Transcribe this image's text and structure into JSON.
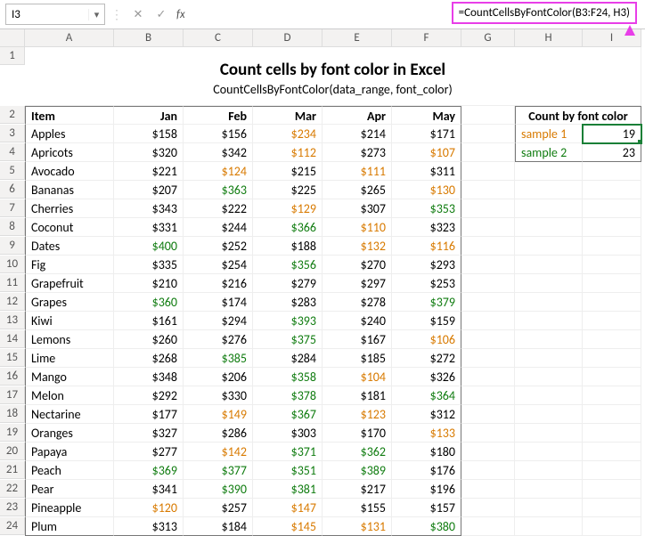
{
  "formula_bar": {
    "cell_ref": "I3",
    "formula_display": "=CountCellsByFontColor(B3:F24, H3)",
    "fx_label": "fx"
  },
  "columns": [
    "A",
    "B",
    "C",
    "D",
    "E",
    "F",
    "G",
    "H",
    "I"
  ],
  "title": {
    "main": "Count cells by font color in Excel",
    "sub": "CountCellsByFontColor(data_range, font_color)"
  },
  "data_headers": {
    "item": "Item",
    "months": [
      "Jan",
      "Feb",
      "Mar",
      "Apr",
      "May"
    ]
  },
  "count_box": {
    "header": "Count by font color",
    "rows": [
      {
        "label": "sample 1",
        "color": "org",
        "value": "19"
      },
      {
        "label": "sample 2",
        "color": "grn",
        "value": "23"
      }
    ]
  },
  "rows": [
    {
      "n": "3",
      "item": "Apples",
      "v": [
        {
          "t": "$158",
          "c": "blk"
        },
        {
          "t": "$156",
          "c": "blk"
        },
        {
          "t": "$234",
          "c": "org"
        },
        {
          "t": "$214",
          "c": "blk"
        },
        {
          "t": "$171",
          "c": "blk"
        }
      ]
    },
    {
      "n": "4",
      "item": "Apricots",
      "v": [
        {
          "t": "$320",
          "c": "blk"
        },
        {
          "t": "$342",
          "c": "blk"
        },
        {
          "t": "$112",
          "c": "org"
        },
        {
          "t": "$273",
          "c": "blk"
        },
        {
          "t": "$107",
          "c": "org"
        }
      ]
    },
    {
      "n": "5",
      "item": "Avocado",
      "v": [
        {
          "t": "$221",
          "c": "blk"
        },
        {
          "t": "$124",
          "c": "org"
        },
        {
          "t": "$215",
          "c": "blk"
        },
        {
          "t": "$111",
          "c": "org"
        },
        {
          "t": "$311",
          "c": "blk"
        }
      ]
    },
    {
      "n": "6",
      "item": "Bananas",
      "v": [
        {
          "t": "$207",
          "c": "blk"
        },
        {
          "t": "$363",
          "c": "grn"
        },
        {
          "t": "$225",
          "c": "blk"
        },
        {
          "t": "$265",
          "c": "blk"
        },
        {
          "t": "$130",
          "c": "org"
        }
      ]
    },
    {
      "n": "7",
      "item": "Cherries",
      "v": [
        {
          "t": "$343",
          "c": "blk"
        },
        {
          "t": "$222",
          "c": "blk"
        },
        {
          "t": "$129",
          "c": "org"
        },
        {
          "t": "$307",
          "c": "blk"
        },
        {
          "t": "$353",
          "c": "grn"
        }
      ]
    },
    {
      "n": "8",
      "item": "Coconut",
      "v": [
        {
          "t": "$331",
          "c": "blk"
        },
        {
          "t": "$244",
          "c": "blk"
        },
        {
          "t": "$366",
          "c": "grn"
        },
        {
          "t": "$110",
          "c": "org"
        },
        {
          "t": "$323",
          "c": "blk"
        }
      ]
    },
    {
      "n": "9",
      "item": "Dates",
      "v": [
        {
          "t": "$400",
          "c": "grn"
        },
        {
          "t": "$252",
          "c": "blk"
        },
        {
          "t": "$188",
          "c": "blk"
        },
        {
          "t": "$132",
          "c": "org"
        },
        {
          "t": "$116",
          "c": "org"
        }
      ]
    },
    {
      "n": "10",
      "item": "Fig",
      "v": [
        {
          "t": "$335",
          "c": "blk"
        },
        {
          "t": "$254",
          "c": "blk"
        },
        {
          "t": "$356",
          "c": "grn"
        },
        {
          "t": "$270",
          "c": "blk"
        },
        {
          "t": "$293",
          "c": "blk"
        }
      ]
    },
    {
      "n": "11",
      "item": "Grapefruit",
      "v": [
        {
          "t": "$210",
          "c": "blk"
        },
        {
          "t": "$216",
          "c": "blk"
        },
        {
          "t": "$279",
          "c": "blk"
        },
        {
          "t": "$297",
          "c": "blk"
        },
        {
          "t": "$253",
          "c": "blk"
        }
      ]
    },
    {
      "n": "12",
      "item": "Grapes",
      "v": [
        {
          "t": "$360",
          "c": "grn"
        },
        {
          "t": "$174",
          "c": "blk"
        },
        {
          "t": "$283",
          "c": "blk"
        },
        {
          "t": "$278",
          "c": "blk"
        },
        {
          "t": "$379",
          "c": "grn"
        }
      ]
    },
    {
      "n": "13",
      "item": "Kiwi",
      "v": [
        {
          "t": "$161",
          "c": "blk"
        },
        {
          "t": "$294",
          "c": "blk"
        },
        {
          "t": "$393",
          "c": "grn"
        },
        {
          "t": "$240",
          "c": "blk"
        },
        {
          "t": "$159",
          "c": "blk"
        }
      ]
    },
    {
      "n": "14",
      "item": "Lemons",
      "v": [
        {
          "t": "$260",
          "c": "blk"
        },
        {
          "t": "$276",
          "c": "blk"
        },
        {
          "t": "$375",
          "c": "grn"
        },
        {
          "t": "$167",
          "c": "blk"
        },
        {
          "t": "$106",
          "c": "org"
        }
      ]
    },
    {
      "n": "15",
      "item": "Lime",
      "v": [
        {
          "t": "$268",
          "c": "blk"
        },
        {
          "t": "$385",
          "c": "grn"
        },
        {
          "t": "$284",
          "c": "blk"
        },
        {
          "t": "$185",
          "c": "blk"
        },
        {
          "t": "$272",
          "c": "blk"
        }
      ]
    },
    {
      "n": "16",
      "item": "Mango",
      "v": [
        {
          "t": "$348",
          "c": "blk"
        },
        {
          "t": "$206",
          "c": "blk"
        },
        {
          "t": "$358",
          "c": "grn"
        },
        {
          "t": "$104",
          "c": "org"
        },
        {
          "t": "$326",
          "c": "blk"
        }
      ]
    },
    {
      "n": "17",
      "item": "Melon",
      "v": [
        {
          "t": "$292",
          "c": "blk"
        },
        {
          "t": "$330",
          "c": "blk"
        },
        {
          "t": "$378",
          "c": "grn"
        },
        {
          "t": "$181",
          "c": "blk"
        },
        {
          "t": "$364",
          "c": "grn"
        }
      ]
    },
    {
      "n": "18",
      "item": "Nectarine",
      "v": [
        {
          "t": "$177",
          "c": "blk"
        },
        {
          "t": "$149",
          "c": "org"
        },
        {
          "t": "$367",
          "c": "grn"
        },
        {
          "t": "$123",
          "c": "org"
        },
        {
          "t": "$312",
          "c": "blk"
        }
      ]
    },
    {
      "n": "19",
      "item": "Oranges",
      "v": [
        {
          "t": "$327",
          "c": "blk"
        },
        {
          "t": "$286",
          "c": "blk"
        },
        {
          "t": "$303",
          "c": "blk"
        },
        {
          "t": "$170",
          "c": "blk"
        },
        {
          "t": "$133",
          "c": "org"
        }
      ]
    },
    {
      "n": "20",
      "item": "Papaya",
      "v": [
        {
          "t": "$277",
          "c": "blk"
        },
        {
          "t": "$142",
          "c": "org"
        },
        {
          "t": "$371",
          "c": "grn"
        },
        {
          "t": "$362",
          "c": "grn"
        },
        {
          "t": "$180",
          "c": "blk"
        }
      ]
    },
    {
      "n": "21",
      "item": "Peach",
      "v": [
        {
          "t": "$369",
          "c": "grn"
        },
        {
          "t": "$377",
          "c": "grn"
        },
        {
          "t": "$351",
          "c": "grn"
        },
        {
          "t": "$389",
          "c": "grn"
        },
        {
          "t": "$176",
          "c": "blk"
        }
      ]
    },
    {
      "n": "22",
      "item": "Pear",
      "v": [
        {
          "t": "$341",
          "c": "blk"
        },
        {
          "t": "$390",
          "c": "grn"
        },
        {
          "t": "$381",
          "c": "grn"
        },
        {
          "t": "$217",
          "c": "blk"
        },
        {
          "t": "$196",
          "c": "blk"
        }
      ]
    },
    {
      "n": "23",
      "item": "Pineapple",
      "v": [
        {
          "t": "$120",
          "c": "org"
        },
        {
          "t": "$257",
          "c": "blk"
        },
        {
          "t": "$147",
          "c": "org"
        },
        {
          "t": "$155",
          "c": "blk"
        },
        {
          "t": "$157",
          "c": "blk"
        }
      ]
    },
    {
      "n": "24",
      "item": "Plum",
      "v": [
        {
          "t": "$313",
          "c": "blk"
        },
        {
          "t": "$184",
          "c": "blk"
        },
        {
          "t": "$145",
          "c": "org"
        },
        {
          "t": "$131",
          "c": "org"
        },
        {
          "t": "$380",
          "c": "grn"
        }
      ]
    }
  ]
}
